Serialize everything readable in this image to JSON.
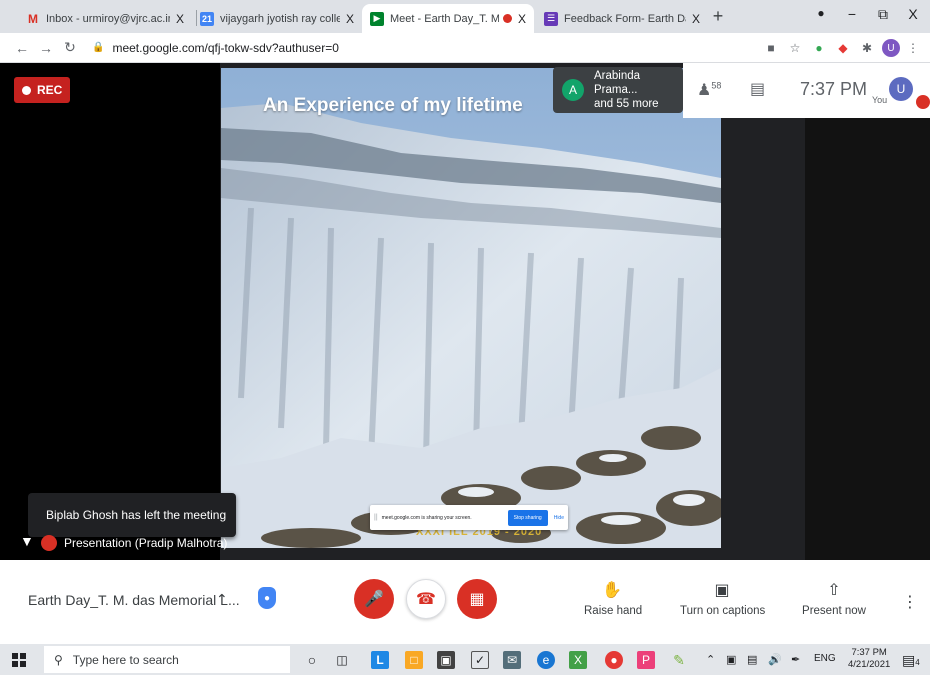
{
  "browser": {
    "tabs": [
      {
        "title": "Inbox - urmiroy@vjrc.ac.in - vijay",
        "favicon": "gmail-icon"
      },
      {
        "title": "vijaygarh jyotish ray college - Cal",
        "favicon": "calendar-icon"
      },
      {
        "title": "Meet - Earth Day_T. M. das M",
        "favicon": "meet-icon",
        "active": true,
        "recording": true
      },
      {
        "title": "Feedback Form- Earth Day Celeb",
        "favicon": "forms-icon"
      }
    ],
    "close_glyph": "X",
    "new_tab_glyph": "+",
    "window_controls": {
      "minimize": "−",
      "restore": "⧉",
      "close": "X"
    },
    "url": "meet.google.com/qfj-tokw-sdv?authuser=0",
    "profile_initial": "U"
  },
  "meet": {
    "rec_label": "REC",
    "participant_chip": {
      "initial": "A",
      "line1": "Arabinda Prama...",
      "line2": "and 55 more"
    },
    "people_count": "58",
    "clock": "7:37 PM",
    "you_label": "You",
    "you_initial": "U",
    "slide": {
      "title": "An Experience of my lifetime",
      "footer": "XXXI ILL 2019 - 2020"
    },
    "share_bar": {
      "grip": "||",
      "message": "meet.google.com is sharing your screen.",
      "stop_label": "Stop sharing",
      "hide_label": "Hide"
    },
    "toast": "Biplab Ghosh has left the meeting",
    "presentation_label": "Presentation (Pradip Malhotra)",
    "meeting_title": "Earth Day_T. M. das Memorial L...",
    "controls": {
      "raise_hand": "Raise hand",
      "captions": "Turn on captions",
      "present": "Present now"
    },
    "colors": {
      "accent_red": "#d93025",
      "chip_green": "#12a46a",
      "meet_blue": "#1a73e8"
    }
  },
  "taskbar": {
    "search_placeholder": "Type here to search",
    "tray_lang": "ENG",
    "time": "7:37 PM",
    "date": "4/21/2021",
    "notif_count": "4"
  }
}
